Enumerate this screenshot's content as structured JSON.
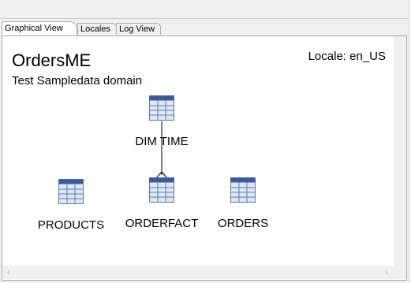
{
  "tabs": [
    {
      "label": "Graphical View",
      "active": true
    },
    {
      "label": "Locales",
      "active": false
    },
    {
      "label": "Log View",
      "active": false
    }
  ],
  "model": {
    "name": "OrdersME",
    "description": "Test Sampledata domain",
    "locale_label": "Locale: en_US"
  },
  "nodes": {
    "dim_time": {
      "label": "DIM TIME",
      "icon": "table-icon"
    },
    "products": {
      "label": "PRODUCTS",
      "icon": "table-icon"
    },
    "orderfact": {
      "label": "ORDERFACT",
      "icon": "table-icon"
    },
    "orders": {
      "label": "ORDERS",
      "icon": "table-icon"
    }
  },
  "relationships": [
    {
      "from": "DIM TIME",
      "to": "ORDERFACT",
      "type": "one-to-many"
    }
  ],
  "colors": {
    "table_header": "#3d5a96",
    "table_grid": "#5b7bb0",
    "table_body": "#dfe7f3"
  },
  "scrollbars": {
    "left_arrow": "‹",
    "right_arrow": "›"
  }
}
